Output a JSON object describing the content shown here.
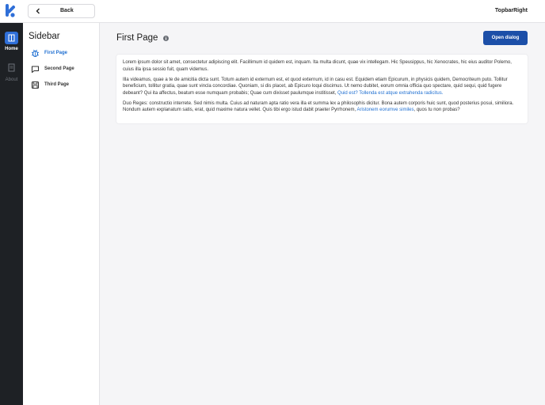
{
  "topbar": {
    "back_label": "Back",
    "right_label": "TopbarRight"
  },
  "rail": {
    "items": [
      {
        "label": "Home",
        "icon": "book-icon"
      },
      {
        "label": "About",
        "icon": "document-icon"
      }
    ]
  },
  "sidebar": {
    "title": "Sidebar",
    "items": [
      {
        "label": "First Page",
        "icon": "bug-icon"
      },
      {
        "label": "Second Page",
        "icon": "chat-icon"
      },
      {
        "label": "Third Page",
        "icon": "save-icon"
      }
    ]
  },
  "main": {
    "title": "First Page",
    "open_dialog_label": "Open dialog",
    "paragraphs": {
      "p1": "Lorem ipsum dolor sit amet, consectetur adipiscing elit. Facillimum id quidem est, inquam. Ita multa dicunt, quae vix intellegam. Hic Speusippus, hic Xenocrates, hic eius auditor Polemo, cuius illa ipsa sessio fuit, quam videmus.",
      "p2_text": "Illa videamus, quae a te de amicitia dicta sunt. Totum autem id externum est, et quod externum, id in casu est. Equidem etiam Epicurum, in physicis quidem, Democriteum puto. Tollitur beneficium, tollitur gratia, quae sunt vincla concordiae. Quoniam, si dis placet, ab Epicuro loqui discimus. Ut nemo dubitet, eorum omnia officia quo spectare, quid sequi, quid fugere debeant? Qui ita affectus, beatum esse numquam probabis; Quae cum dixisset paulumque institisset, ",
      "p2_link": "Quid est? Tollenda est atque extrahenda radicitus.",
      "p3_text": "Duo Reges: constructio interrete. Sed nimis multa. Cuius ad naturam apta ratio vera illa et summa lex a philosophis dicitur. Bona autem corporis huic sunt, quod posterius posui, similiora. Nondum autem explanatum satis, erat, quid maxime natura vellet. Quis tibi ergo istud dabit praeter Pyrrhonem, ",
      "p3_link": "Aristonem eorumve similes",
      "p3_tail": ", quos tu non probas?"
    }
  },
  "colors": {
    "accent": "#1c4fa8",
    "link": "#1f6fd1",
    "rail_bg": "#1e2125",
    "rail_active": "#2f6fd8"
  }
}
